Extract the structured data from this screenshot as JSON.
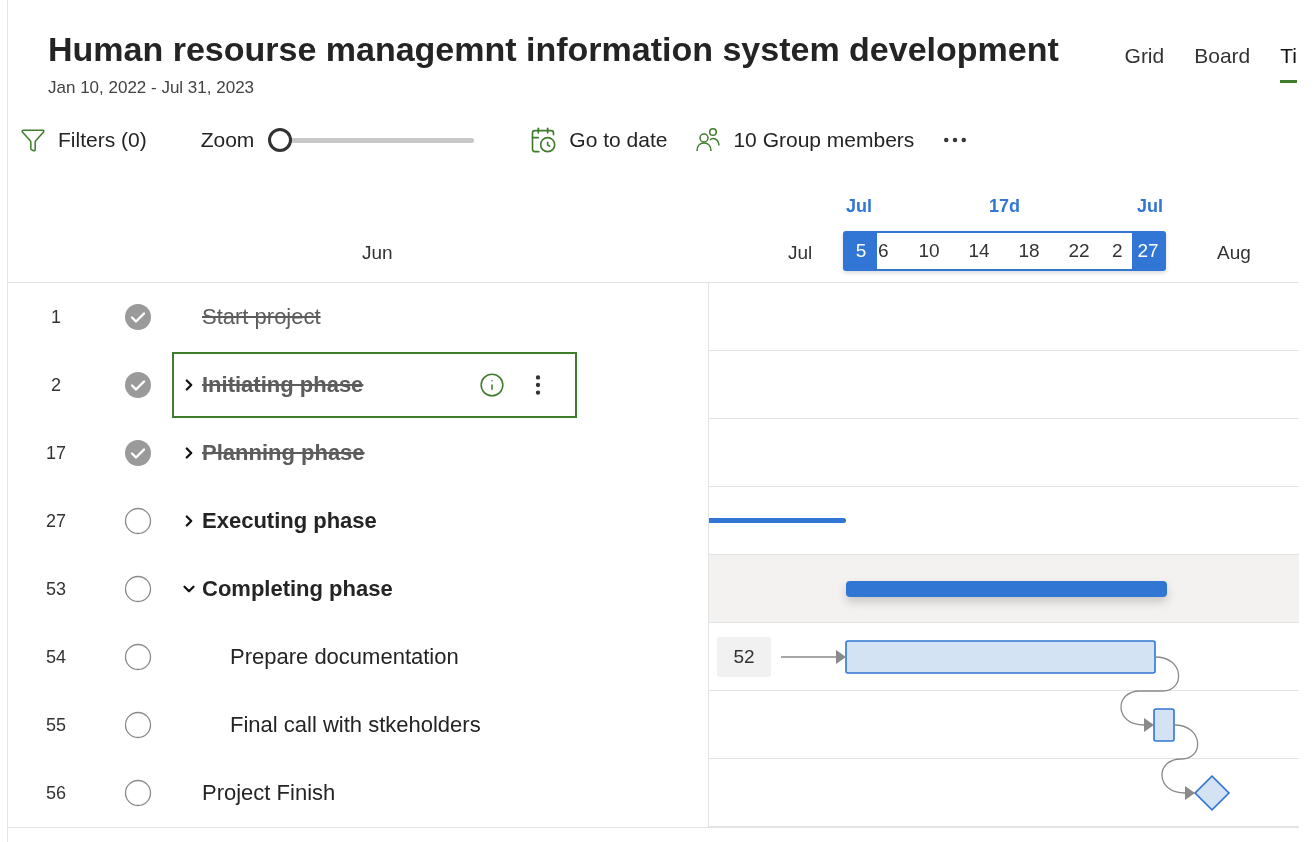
{
  "title": "Human resourse managemnt information system development",
  "date_range": "Jan 10, 2022 - Jul 31, 2023",
  "views": [
    {
      "label": "Grid",
      "selected": false
    },
    {
      "label": "Board",
      "selected": false
    },
    {
      "label": "Ti",
      "selected": true
    }
  ],
  "toolbar": {
    "filters": "Filters (0)",
    "zoom": {
      "label": "Zoom",
      "level": 0
    },
    "go_to_date": "Go to date",
    "members": "10 Group members"
  },
  "timeline": {
    "months": [
      {
        "label": "Jun"
      },
      {
        "label": "Jul"
      },
      {
        "label": "Aug"
      }
    ],
    "range": {
      "start_month": "Jul",
      "end_month": "Jul",
      "duration": "17d",
      "start_day": "5",
      "end_day": "27",
      "ticks": [
        "6",
        "10",
        "14",
        "18",
        "22",
        "2"
      ]
    }
  },
  "tasks": [
    {
      "number": "1",
      "name": "Start project",
      "kind": "task",
      "completed": true,
      "selected": false
    },
    {
      "number": "2",
      "name": "Initiating phase",
      "kind": "summary",
      "completed": true,
      "expanded": false,
      "selected": true
    },
    {
      "number": "17",
      "name": "Planning phase",
      "kind": "summary",
      "completed": true,
      "expanded": false,
      "selected": false
    },
    {
      "number": "27",
      "name": "Executing phase",
      "kind": "summary",
      "completed": false,
      "expanded": false,
      "selected": false
    },
    {
      "number": "53",
      "name": "Completing phase",
      "kind": "summary",
      "completed": false,
      "expanded": true,
      "selected": false,
      "hovered": true,
      "children": [
        {
          "number": "54",
          "name": "Prepare documentation",
          "kind": "task",
          "completed": false,
          "selected": false,
          "predecessor": "52"
        },
        {
          "number": "55",
          "name": "Final call with stkeholders",
          "kind": "task",
          "completed": false,
          "selected": false,
          "linked": true
        }
      ]
    },
    {
      "number": "56",
      "name": "Project Finish",
      "kind": "milestone",
      "completed": false,
      "selected": false,
      "linked": true
    }
  ]
}
